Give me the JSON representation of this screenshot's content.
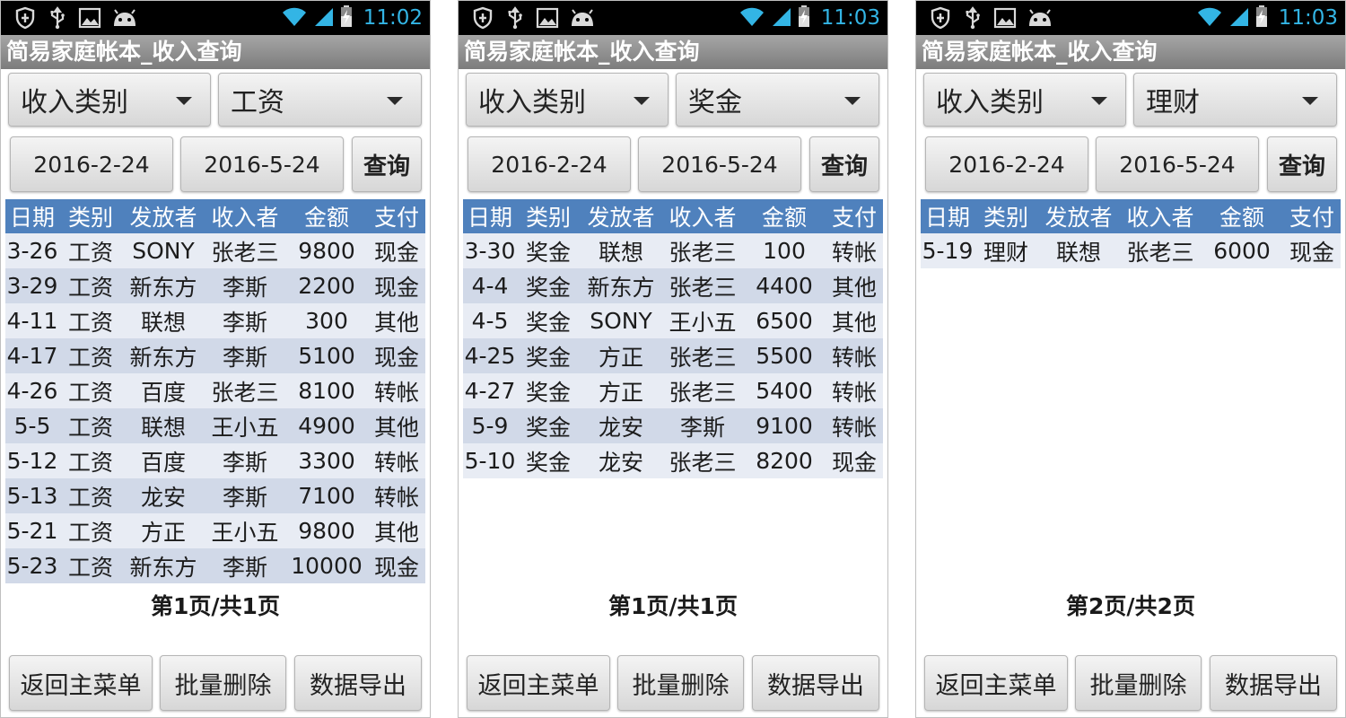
{
  "colors": {
    "header": "#4f81bd",
    "row_light": "#e8ecf4",
    "row_dark": "#d1d9e8",
    "statusbar": "#000000",
    "time": "#33b5e5"
  },
  "screens": [
    {
      "status": {
        "time": "11:02"
      },
      "title": "简易家庭帐本_收入查询",
      "category_label": "收入类别",
      "category_value": "工资",
      "start_date": "2016-2-24",
      "end_date": "2016-5-24",
      "query_label": "查询",
      "columns": [
        "日期",
        "类别",
        "发放者",
        "收入者",
        "金额",
        "支付"
      ],
      "rows": [
        [
          "3-26",
          "工资",
          "SONY",
          "张老三",
          "9800",
          "现金"
        ],
        [
          "3-29",
          "工资",
          "新东方",
          "李斯",
          "2200",
          "现金"
        ],
        [
          "4-11",
          "工资",
          "联想",
          "李斯",
          "300",
          "其他"
        ],
        [
          "4-17",
          "工资",
          "新东方",
          "李斯",
          "5100",
          "现金"
        ],
        [
          "4-26",
          "工资",
          "百度",
          "张老三",
          "8100",
          "转帐"
        ],
        [
          "5-5",
          "工资",
          "联想",
          "王小五",
          "4900",
          "其他"
        ],
        [
          "5-12",
          "工资",
          "百度",
          "李斯",
          "3300",
          "转帐"
        ],
        [
          "5-13",
          "工资",
          "龙安",
          "李斯",
          "7100",
          "转帐"
        ],
        [
          "5-21",
          "工资",
          "方正",
          "王小五",
          "9800",
          "其他"
        ],
        [
          "5-23",
          "工资",
          "新东方",
          "李斯",
          "10000",
          "现金"
        ]
      ],
      "page_info": "第1页/共1页",
      "buttons": {
        "back": "返回主菜单",
        "batch_delete": "批量删除",
        "export": "数据导出"
      }
    },
    {
      "status": {
        "time": "11:03"
      },
      "title": "简易家庭帐本_收入查询",
      "category_label": "收入类别",
      "category_value": "奖金",
      "start_date": "2016-2-24",
      "end_date": "2016-5-24",
      "query_label": "查询",
      "columns": [
        "日期",
        "类别",
        "发放者",
        "收入者",
        "金额",
        "支付"
      ],
      "rows": [
        [
          "3-30",
          "奖金",
          "联想",
          "张老三",
          "100",
          "转帐"
        ],
        [
          "4-4",
          "奖金",
          "新东方",
          "张老三",
          "4400",
          "其他"
        ],
        [
          "4-5",
          "奖金",
          "SONY",
          "王小五",
          "6500",
          "其他"
        ],
        [
          "4-25",
          "奖金",
          "方正",
          "张老三",
          "5500",
          "转帐"
        ],
        [
          "4-27",
          "奖金",
          "方正",
          "张老三",
          "5400",
          "转帐"
        ],
        [
          "5-9",
          "奖金",
          "龙安",
          "李斯",
          "9100",
          "转帐"
        ],
        [
          "5-10",
          "奖金",
          "龙安",
          "张老三",
          "8200",
          "现金"
        ]
      ],
      "page_info": "第1页/共1页",
      "buttons": {
        "back": "返回主菜单",
        "batch_delete": "批量删除",
        "export": "数据导出"
      }
    },
    {
      "status": {
        "time": "11:03"
      },
      "title": "简易家庭帐本_收入查询",
      "category_label": "收入类别",
      "category_value": "理财",
      "start_date": "2016-2-24",
      "end_date": "2016-5-24",
      "query_label": "查询",
      "columns": [
        "日期",
        "类别",
        "发放者",
        "收入者",
        "金额",
        "支付"
      ],
      "rows": [
        [
          "5-19",
          "理财",
          "联想",
          "张老三",
          "6000",
          "现金"
        ]
      ],
      "page_info": "第2页/共2页",
      "buttons": {
        "back": "返回主菜单",
        "batch_delete": "批量删除",
        "export": "数据导出"
      }
    }
  ]
}
